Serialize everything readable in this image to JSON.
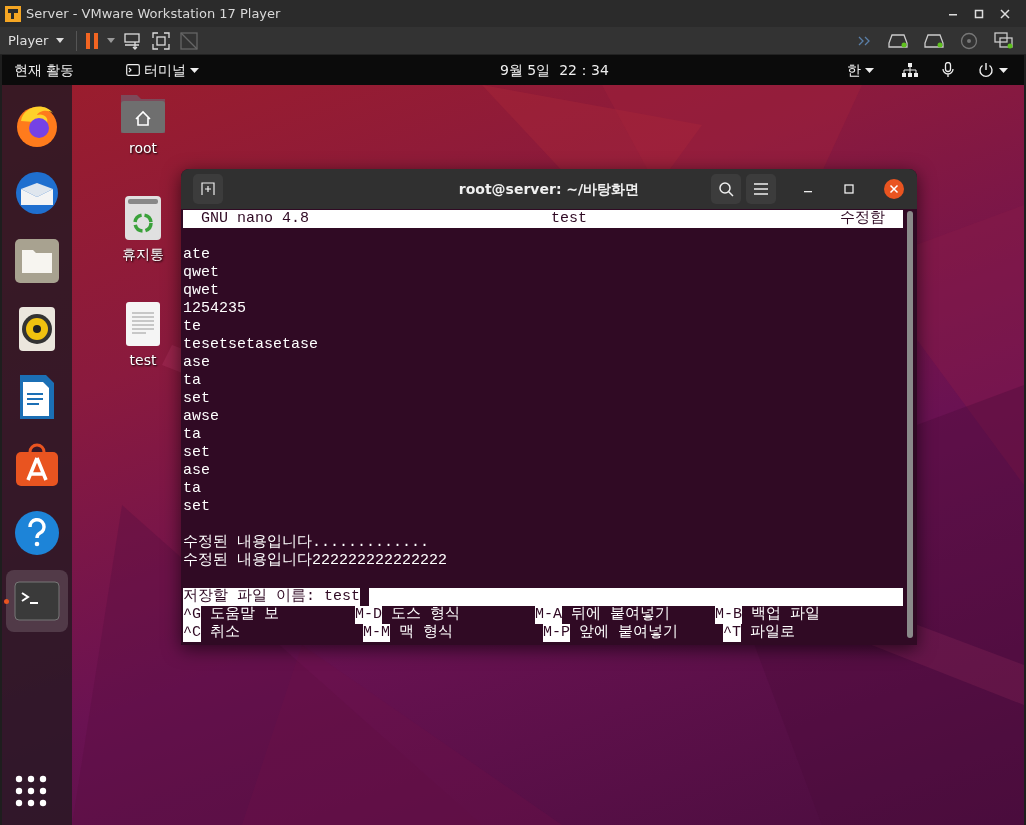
{
  "window": {
    "title": "Server - VMware Workstation 17 Player"
  },
  "toolbar": {
    "player_menu": "Player"
  },
  "top_bar": {
    "activities": "현재 활동",
    "app_menu": "터미널",
    "clock": "9월 5일  22：34",
    "input_method": "한"
  },
  "dock": {
    "items": [
      {
        "kind": "browser",
        "selected": false,
        "running": false
      },
      {
        "kind": "mail",
        "selected": false,
        "running": false
      },
      {
        "kind": "files",
        "selected": false,
        "running": false
      },
      {
        "kind": "music",
        "selected": false,
        "running": false
      },
      {
        "kind": "writer",
        "selected": false,
        "running": false
      },
      {
        "kind": "store",
        "selected": false,
        "running": false
      },
      {
        "kind": "help",
        "selected": false,
        "running": false
      },
      {
        "kind": "terminal",
        "selected": true,
        "running": true
      }
    ]
  },
  "desktop_icons": [
    {
      "kind": "folder",
      "label": "root"
    },
    {
      "kind": "trash",
      "label": "휴지통"
    },
    {
      "kind": "document",
      "label": "test"
    }
  ],
  "terminal": {
    "title": "root@server: ~/바탕화면",
    "nano": {
      "version": "GNU nano 4.8",
      "filename": "test",
      "status": "수정함",
      "blocks": [
        [
          "ate",
          "qwet",
          "qwet",
          "1254235",
          "te",
          "tesetsetasetase",
          "ase",
          "ta",
          "set",
          "awse",
          "ta",
          "set",
          "ase",
          "ta",
          "set"
        ],
        [
          "수정된 내용입니다.............",
          "수정된 내용입니다222222222222222"
        ]
      ],
      "prompt": "저장할 파일 이름: test",
      "shortcuts": [
        [
          {
            "key": "^G",
            "label": "도움말 보"
          },
          {
            "key": "M-D",
            "label": "도스 형식"
          },
          {
            "key": "M-A",
            "label": "뒤에 붙여넣기"
          },
          {
            "key": "M-B",
            "label": "백업 파일"
          }
        ],
        [
          {
            "key": "^C",
            "label": "취소"
          },
          {
            "key": "M-M",
            "label": "맥 형식"
          },
          {
            "key": "M-P",
            "label": "앞에 붙여넣기"
          },
          {
            "key": "^T",
            "label": "파일로"
          }
        ]
      ]
    }
  }
}
